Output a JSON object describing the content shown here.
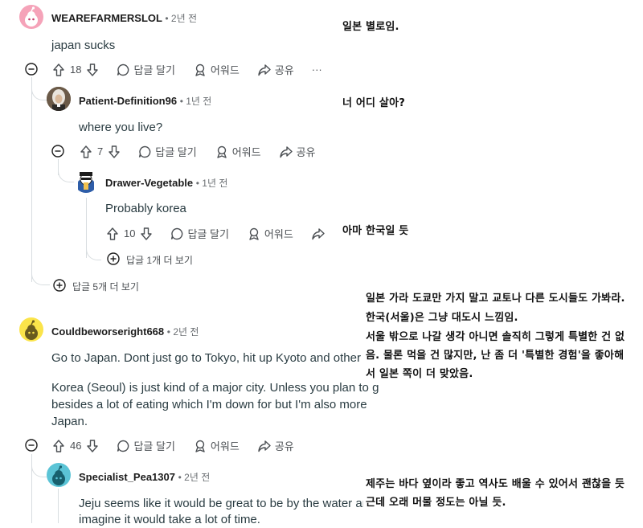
{
  "comments": [
    {
      "author": "WEAREFARMERSLOL",
      "age": "2년 전",
      "text": "japan sucks",
      "votes": "18"
    },
    {
      "author": "Patient-Definition96",
      "age": "1년 전",
      "text": "where you live?",
      "votes": "7"
    },
    {
      "author": "Drawer-Vegetable",
      "age": "1년 전",
      "text": "Probably korea",
      "votes": "10"
    },
    {
      "author": "Couldbeworseright668",
      "age": "2년 전",
      "text1": "Go to Japan. Dont just go to Tokyo, hit up Kyoto and other ci",
      "text2a": "Korea (Seoul) is just kind of a major city. Unless you plan to g",
      "text2b": "besides a lot of eating which I'm down for but I'm also more",
      "text2c": "Japan.",
      "votes": "46"
    },
    {
      "author": "Specialist_Pea1307",
      "age": "2년 전",
      "text1": "Jeju seems like it would be great to be by the water anc",
      "text2": "imagine it would take a lot of time."
    }
  ],
  "actions": {
    "reply": "답글 달기",
    "award": "어워드",
    "share": "공유",
    "more": "···"
  },
  "more_replies": {
    "one": "답글 1개 더 보기",
    "five": "답글 5개 더 보기"
  },
  "translations": {
    "t1": "일본 별로임.",
    "t2": "너 어디 살아?",
    "t3": "아마 한국일 듯",
    "t4a": "일본 가라 도쿄만 가지 말고 교토나 다른 도시들도 가봐라.",
    "t4b": "한국(서울)은 그냥 대도시 느낌임.",
    "t4c": "서울 밖으로 나갈 생각 아니면 솔직히 그렇게 특별한 건 없",
    "t4d": "음. 물론 먹을 건 많지만, 난 좀 더 '특별한 경험'을 좋아해",
    "t4e": "서 일본 쪽이 더 맞았음.",
    "t5a": "제주는 바다 옆이라 좋고 역사도 배울 수 있어서 괜찮을 듯",
    "t5b": "근데 오래 머물 정도는 아닐 듯."
  },
  "colors": {
    "accent": "#ff4500",
    "line": "#d8dde0",
    "muted": "#6b6f73"
  }
}
